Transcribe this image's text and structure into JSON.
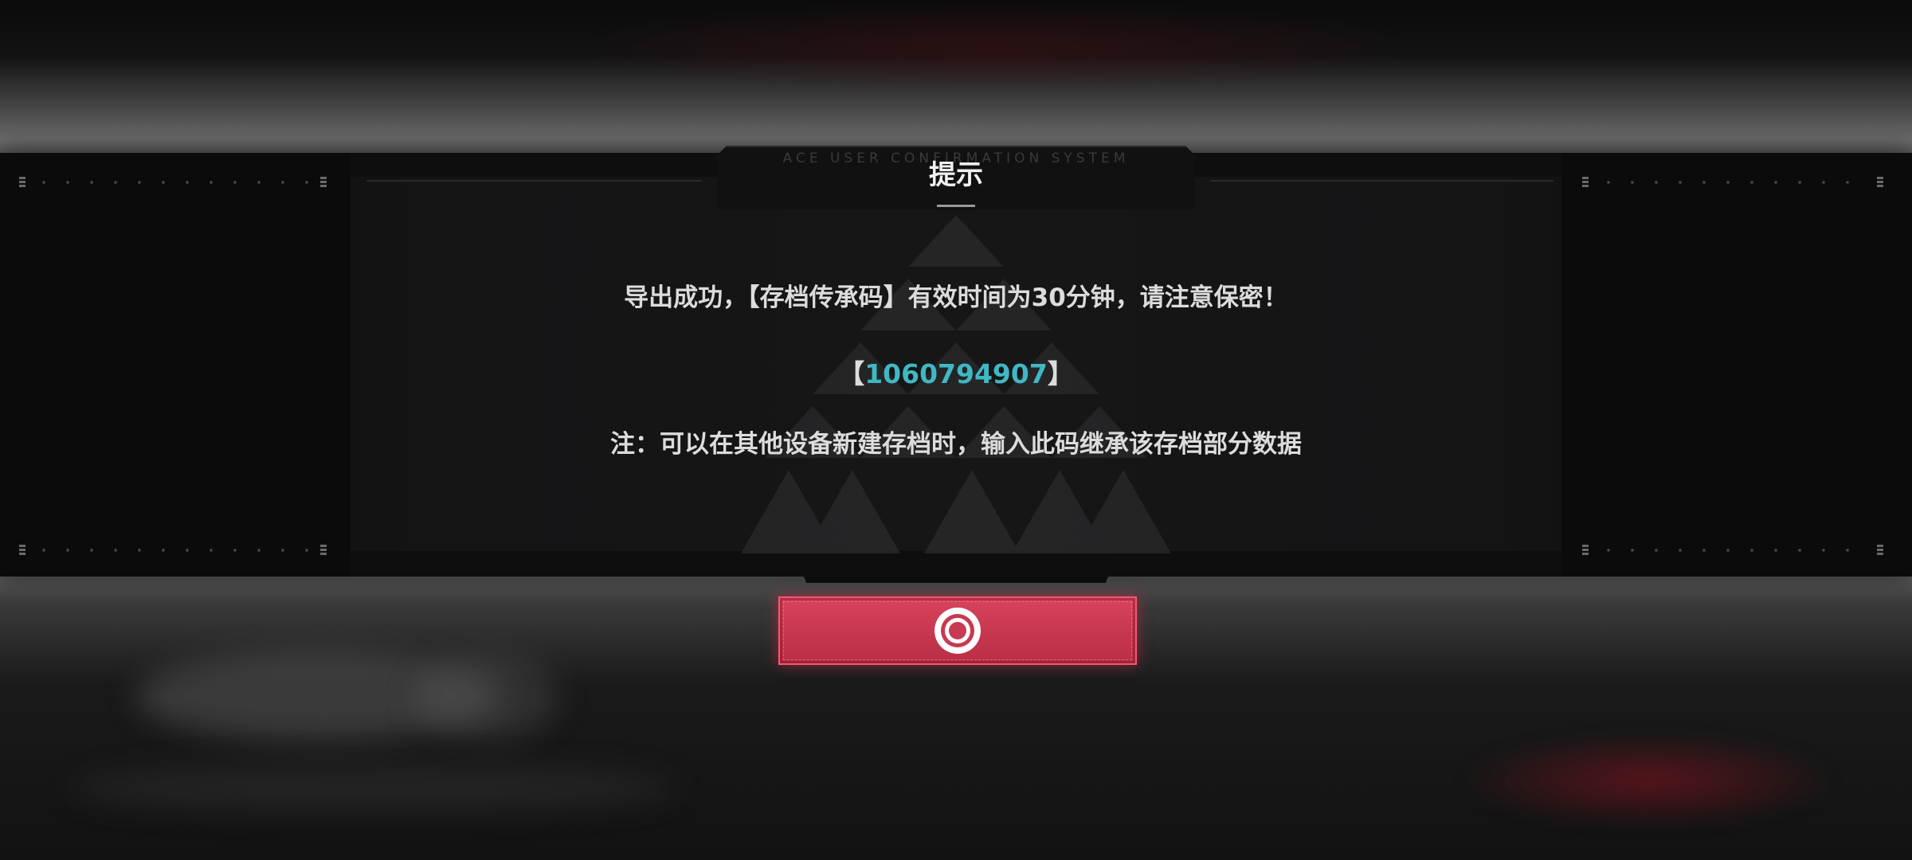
{
  "dialog": {
    "system_label": "ACE USER CONFIRMATION SYSTEM",
    "title": "提示",
    "message_line1": "导出成功，【存档传承码】有效时间为30分钟，请注意保密！",
    "code_open": "【",
    "code_value": "1060794907",
    "code_close": "】",
    "note": "注：可以在其他设备新建存档时，输入此码继承该存档部分数据",
    "confirm_icon": "ring-target-icon"
  },
  "colors": {
    "code_accent": "#3fb8c4",
    "button_red": "#c8384f",
    "text": "#dcdcdc"
  }
}
